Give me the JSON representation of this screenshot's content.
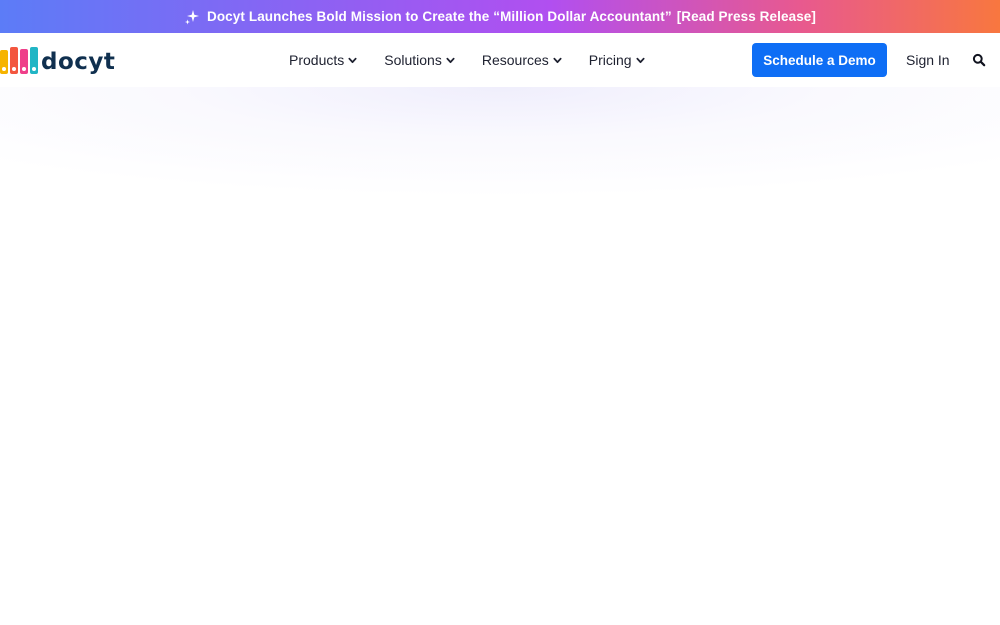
{
  "announcement": {
    "icon": "sparkle-icon",
    "text": "Docyt Launches Bold Mission to Create the “Million Dollar Accountant”",
    "link_label": "[Read Press Release]",
    "gradient_colors": [
      "#5c7cf7",
      "#b14ff0",
      "#f8773f"
    ]
  },
  "header": {
    "logo_text": "docyt",
    "logo_colors": [
      "#f6b400",
      "#f3563f",
      "#ef3f8a",
      "#21b5c5"
    ],
    "nav": [
      {
        "label": "Products",
        "icon": "chevron-down-icon"
      },
      {
        "label": "Solutions",
        "icon": "chevron-down-icon"
      },
      {
        "label": "Resources",
        "icon": "chevron-down-icon"
      },
      {
        "label": "Pricing",
        "icon": "chevron-down-icon"
      }
    ],
    "cta_label": "Schedule a Demo",
    "cta_color": "#0e6ef5",
    "signin_label": "Sign In",
    "search_icon": "search-icon"
  }
}
